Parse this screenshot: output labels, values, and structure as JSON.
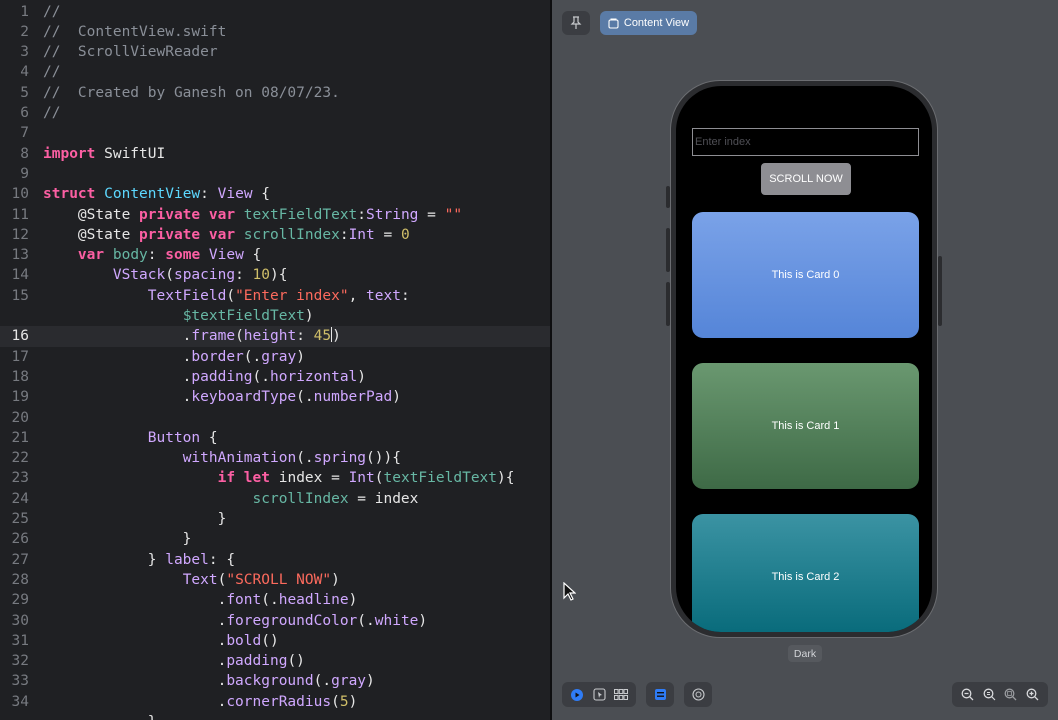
{
  "editor": {
    "current_line": 16,
    "lines": [
      {
        "n": "1",
        "tokens": [
          [
            "c",
            "//"
          ]
        ]
      },
      {
        "n": "2",
        "tokens": [
          [
            "c",
            "//  ContentView.swift"
          ]
        ]
      },
      {
        "n": "3",
        "tokens": [
          [
            "c",
            "//  ScrollViewReader"
          ]
        ]
      },
      {
        "n": "4",
        "tokens": [
          [
            "c",
            "//"
          ]
        ]
      },
      {
        "n": "5",
        "tokens": [
          [
            "c",
            "//  Created by Ganesh on 08/07/23."
          ]
        ]
      },
      {
        "n": "6",
        "tokens": [
          [
            "c",
            "//"
          ]
        ]
      },
      {
        "n": "7",
        "tokens": []
      },
      {
        "n": "8",
        "tokens": [
          [
            "k",
            "import"
          ],
          [
            "p",
            " SwiftUI"
          ]
        ]
      },
      {
        "n": "9",
        "tokens": []
      },
      {
        "n": "10",
        "tokens": [
          [
            "k",
            "struct"
          ],
          [
            "p",
            " "
          ],
          [
            "t",
            "ContentView"
          ],
          [
            "p",
            ": "
          ],
          [
            "f",
            "View"
          ],
          [
            "p",
            " {"
          ]
        ]
      },
      {
        "n": "11",
        "tokens": [
          [
            "p",
            "    @State "
          ],
          [
            "k",
            "private var"
          ],
          [
            "p",
            " "
          ],
          [
            "r",
            "textFieldText"
          ],
          [
            "p",
            ":"
          ],
          [
            "f",
            "String"
          ],
          [
            "p",
            " = "
          ],
          [
            "s",
            "\"\""
          ]
        ]
      },
      {
        "n": "12",
        "tokens": [
          [
            "p",
            "    @State "
          ],
          [
            "k",
            "private var"
          ],
          [
            "p",
            " "
          ],
          [
            "r",
            "scrollIndex"
          ],
          [
            "p",
            ":"
          ],
          [
            "f",
            "Int"
          ],
          [
            "p",
            " = "
          ],
          [
            "n",
            "0"
          ]
        ]
      },
      {
        "n": "13",
        "tokens": [
          [
            "p",
            "    "
          ],
          [
            "k",
            "var"
          ],
          [
            "p",
            " "
          ],
          [
            "r",
            "body"
          ],
          [
            "p",
            ": "
          ],
          [
            "k",
            "some"
          ],
          [
            "p",
            " "
          ],
          [
            "f",
            "View"
          ],
          [
            "p",
            " {"
          ]
        ]
      },
      {
        "n": "14",
        "tokens": [
          [
            "p",
            "        "
          ],
          [
            "f",
            "VStack"
          ],
          [
            "p",
            "("
          ],
          [
            "f",
            "spacing"
          ],
          [
            "p",
            ": "
          ],
          [
            "n",
            "10"
          ],
          [
            "p",
            "){"
          ]
        ]
      },
      {
        "n": "15",
        "tokens": [
          [
            "p",
            "            "
          ],
          [
            "f",
            "TextField"
          ],
          [
            "p",
            "("
          ],
          [
            "s",
            "\"Enter index\""
          ],
          [
            "p",
            ", "
          ],
          [
            "f",
            "text"
          ],
          [
            "p",
            ":"
          ]
        ]
      },
      {
        "n": "",
        "tokens": [
          [
            "p",
            "                "
          ],
          [
            "r",
            "$textFieldText"
          ],
          [
            "p",
            ")"
          ]
        ]
      },
      {
        "n": "16",
        "tokens": [
          [
            "p",
            "                ."
          ],
          [
            "f",
            "frame"
          ],
          [
            "p",
            "("
          ],
          [
            "f",
            "height"
          ],
          [
            "p",
            ": "
          ],
          [
            "n",
            "45"
          ],
          [
            "cursor",
            ""
          ],
          [
            "p",
            ")"
          ]
        ]
      },
      {
        "n": "17",
        "tokens": [
          [
            "p",
            "                ."
          ],
          [
            "f",
            "border"
          ],
          [
            "p",
            "(."
          ],
          [
            "f",
            "gray"
          ],
          [
            "p",
            ")"
          ]
        ]
      },
      {
        "n": "18",
        "tokens": [
          [
            "p",
            "                ."
          ],
          [
            "f",
            "padding"
          ],
          [
            "p",
            "(."
          ],
          [
            "f",
            "horizontal"
          ],
          [
            "p",
            ")"
          ]
        ]
      },
      {
        "n": "19",
        "tokens": [
          [
            "p",
            "                ."
          ],
          [
            "f",
            "keyboardType"
          ],
          [
            "p",
            "(."
          ],
          [
            "f",
            "numberPad"
          ],
          [
            "p",
            ")"
          ]
        ]
      },
      {
        "n": "20",
        "tokens": []
      },
      {
        "n": "21",
        "tokens": [
          [
            "p",
            "            "
          ],
          [
            "f",
            "Button"
          ],
          [
            "p",
            " {"
          ]
        ]
      },
      {
        "n": "22",
        "tokens": [
          [
            "p",
            "                "
          ],
          [
            "f",
            "withAnimation"
          ],
          [
            "p",
            "(."
          ],
          [
            "f",
            "spring"
          ],
          [
            "p",
            "()){"
          ]
        ]
      },
      {
        "n": "23",
        "tokens": [
          [
            "p",
            "                    "
          ],
          [
            "k",
            "if let"
          ],
          [
            "p",
            " index = "
          ],
          [
            "f",
            "Int"
          ],
          [
            "p",
            "("
          ],
          [
            "r",
            "textFieldText"
          ],
          [
            "p",
            "){"
          ]
        ]
      },
      {
        "n": "24",
        "tokens": [
          [
            "p",
            "                        "
          ],
          [
            "r",
            "scrollIndex"
          ],
          [
            "p",
            " = index"
          ]
        ]
      },
      {
        "n": "25",
        "tokens": [
          [
            "p",
            "                    }"
          ]
        ]
      },
      {
        "n": "26",
        "tokens": [
          [
            "p",
            "                }"
          ]
        ]
      },
      {
        "n": "27",
        "tokens": [
          [
            "p",
            "            } "
          ],
          [
            "f",
            "label"
          ],
          [
            "p",
            ": {"
          ]
        ]
      },
      {
        "n": "28",
        "tokens": [
          [
            "p",
            "                "
          ],
          [
            "f",
            "Text"
          ],
          [
            "p",
            "("
          ],
          [
            "s",
            "\"SCROLL NOW\""
          ],
          [
            "p",
            ")"
          ]
        ]
      },
      {
        "n": "29",
        "tokens": [
          [
            "p",
            "                    ."
          ],
          [
            "f",
            "font"
          ],
          [
            "p",
            "(."
          ],
          [
            "f",
            "headline"
          ],
          [
            "p",
            ")"
          ]
        ]
      },
      {
        "n": "30",
        "tokens": [
          [
            "p",
            "                    ."
          ],
          [
            "f",
            "foregroundColor"
          ],
          [
            "p",
            "(."
          ],
          [
            "f",
            "white"
          ],
          [
            "p",
            ")"
          ]
        ]
      },
      {
        "n": "31",
        "tokens": [
          [
            "p",
            "                    ."
          ],
          [
            "f",
            "bold"
          ],
          [
            "p",
            "()"
          ]
        ]
      },
      {
        "n": "32",
        "tokens": [
          [
            "p",
            "                    ."
          ],
          [
            "f",
            "padding"
          ],
          [
            "p",
            "()"
          ]
        ]
      },
      {
        "n": "33",
        "tokens": [
          [
            "p",
            "                    ."
          ],
          [
            "f",
            "background"
          ],
          [
            "p",
            "(."
          ],
          [
            "f",
            "gray"
          ],
          [
            "p",
            ")"
          ]
        ]
      },
      {
        "n": "34",
        "tokens": [
          [
            "p",
            "                    ."
          ],
          [
            "f",
            "cornerRadius"
          ],
          [
            "p",
            "("
          ],
          [
            "n",
            "5"
          ],
          [
            "p",
            ")"
          ]
        ]
      },
      {
        "n": "",
        "tokens": [
          [
            "p",
            "            }"
          ]
        ]
      }
    ]
  },
  "canvas": {
    "pin_icon": "pin-icon",
    "preview_button_label": "Content View",
    "color_scheme_label": "Dark",
    "preview": {
      "field_placeholder": "Enter index",
      "scroll_button_label": "SCROLL NOW",
      "cards": [
        "This is Card 0",
        "This is Card 1",
        "This is Card 2"
      ]
    }
  }
}
